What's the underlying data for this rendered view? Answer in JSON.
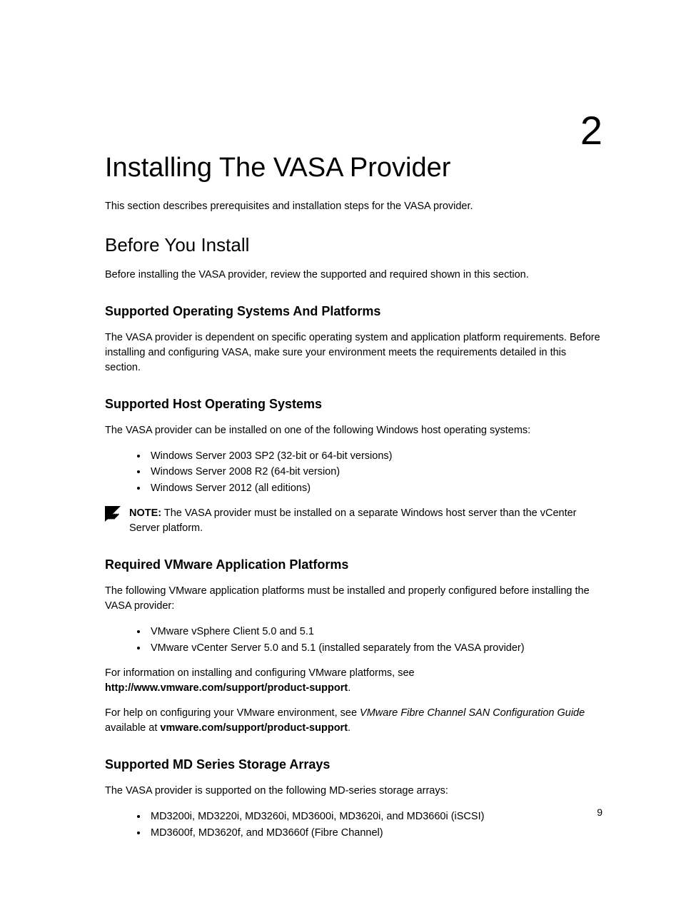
{
  "chapter_number": "2",
  "h1": "Installing The VASA Provider",
  "intro": "This section describes prerequisites and installation steps for the VASA provider.",
  "h2_before": "Before You Install",
  "before_intro": "Before installing the VASA provider, review the supported and required shown in this section.",
  "h3_os": "Supported Operating Systems And Platforms",
  "os_text": "The VASA provider is dependent on specific operating system and application platform requirements. Before installing and configuring VASA, make sure your environment meets the requirements detailed in this section.",
  "h3_host": "Supported Host Operating Systems",
  "host_intro": "The VASA provider can be installed on one of the following Windows host operating systems:",
  "host_list": [
    "Windows Server 2003 SP2 (32-bit or 64-bit versions)",
    "Windows Server 2008 R2 (64-bit version)",
    "Windows Server 2012 (all editions)"
  ],
  "note_label": "NOTE:",
  "note_text": "The VASA provider must be installed on a separate Windows host server than the vCenter Server platform.",
  "h3_vmware": "Required VMware Application Platforms",
  "vmware_intro": "The following VMware application platforms must be installed and properly configured before installing the VASA provider:",
  "vmware_list": [
    "VMware vSphere Client 5.0 and 5.1",
    "VMware vCenter Server 5.0 and 5.1 (installed separately from the VASA provider)"
  ],
  "vmware_info_1a": "For information on installing and configuring VMware platforms, see ",
  "vmware_info_1b": "http://www.vmware.com/support/product-support",
  "vmware_info_1c": ".",
  "vmware_info_2a": "For help on configuring your VMware environment, see ",
  "vmware_info_2b": "VMware Fibre Channel SAN Configuration Guide",
  "vmware_info_2c": " available at ",
  "vmware_info_2d": "vmware.com/support/product-support",
  "vmware_info_2e": ".",
  "h3_md": "Supported MD Series Storage Arrays",
  "md_intro": "The VASA provider is supported on the following MD-series storage arrays:",
  "md_list": [
    "MD3200i, MD3220i, MD3260i, MD3600i, MD3620i, and MD3660i (iSCSI)",
    "MD3600f, MD3620f, and MD3660f (Fibre Channel)"
  ],
  "page_number": "9"
}
